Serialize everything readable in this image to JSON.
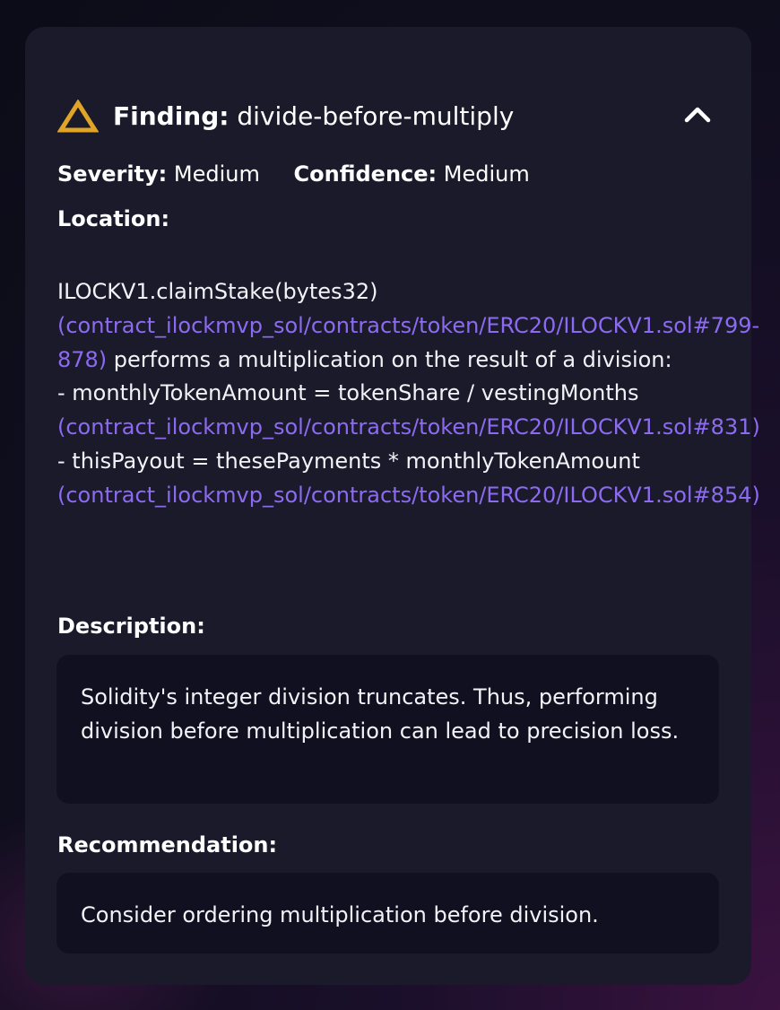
{
  "finding": {
    "label": "Finding:",
    "name": "divide-before-multiply",
    "icon": "warning-triangle-icon",
    "icon_color": "#e0a526",
    "toggle_icon": "chevron-up-icon"
  },
  "meta": {
    "severity_label": "Severity:",
    "severity_value": "Medium",
    "confidence_label": "Confidence:",
    "confidence_value": "Medium"
  },
  "location": {
    "label": "Location:",
    "line1_text": "ILOCKV1.claimStake(bytes32)",
    "line1_link": "(contract_ilockmvp_sol/contracts/token/ERC20/ILOCKV1.sol#799-878)",
    "line1_suffix": " performs a multiplication on the result of a division:",
    "item1_text": "- monthlyTokenAmount = tokenShare / vestingMonths",
    "item1_link": "(contract_ilockmvp_sol/contracts/token/ERC20/ILOCKV1.sol#831)",
    "item2_text": "- thisPayout = thesePayments * monthlyTokenAmount",
    "item2_link": "(contract_ilockmvp_sol/contracts/token/ERC20/ILOCKV1.sol#854)"
  },
  "description": {
    "label": "Description:",
    "text": "Solidity's integer division truncates. Thus, performing division before multiplication can lead to precision loss."
  },
  "recommendation": {
    "label": "Recommendation:",
    "text": "Consider ordering multiplication before division."
  },
  "colors": {
    "card_bg": "#1b1a2b",
    "box_bg": "#111020",
    "link": "#8c6bf0",
    "warning": "#e0a526"
  }
}
